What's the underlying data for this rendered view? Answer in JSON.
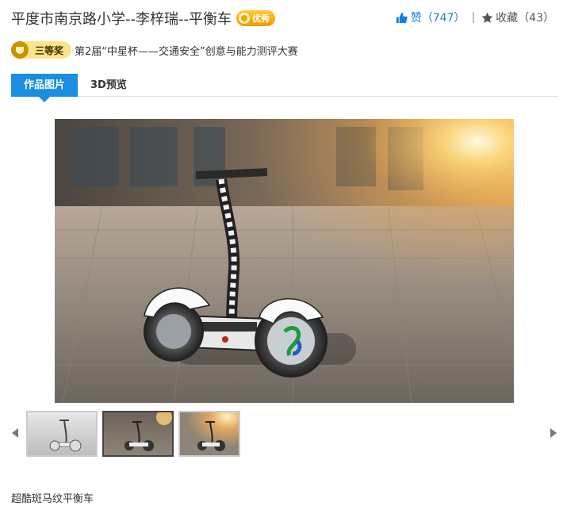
{
  "header": {
    "title": "平度市南京路小学--李梓瑞--平衡车",
    "badge_label": "优秀",
    "like_label": "赞",
    "like_count": "（747）",
    "separator": "|",
    "favorite_label": "收藏",
    "favorite_count": "（43）"
  },
  "award": {
    "rank_label": "三等奖",
    "contest": "第2届“中星杯——交通安全”创意与能力测评大赛"
  },
  "tabs": [
    {
      "label": "作品图片",
      "active": true
    },
    {
      "label": "3D预览",
      "active": false
    }
  ],
  "gallery": {
    "thumbnails": [
      {
        "name": "white-render"
      },
      {
        "name": "plaza-dark",
        "selected": true
      },
      {
        "name": "plaza-sunlit"
      }
    ]
  },
  "description": "超酷斑马纹平衡车",
  "colors": {
    "accent": "#1a8ee0",
    "like": "#1a7fe0",
    "award": "#fde48a",
    "badge": "#f39a00"
  }
}
